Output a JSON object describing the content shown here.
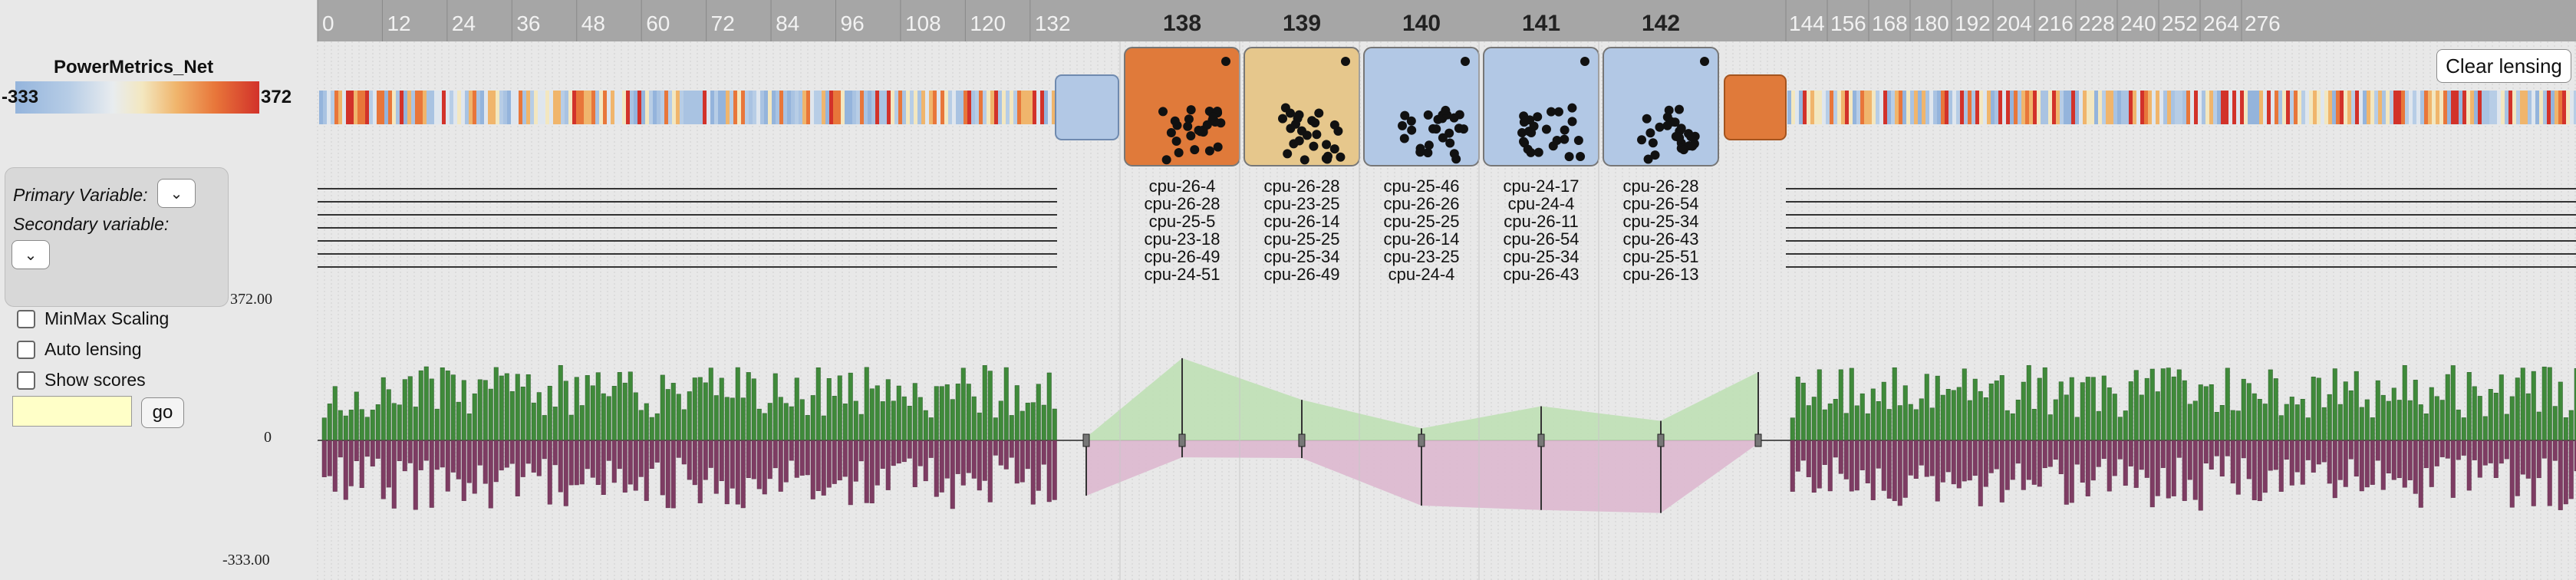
{
  "legend": {
    "title": "PowerMetrics_Net",
    "min_label": "-333",
    "max_label": "372"
  },
  "controls": {
    "primary_label": "Primary Variable:",
    "secondary_label": "Secondary variable:",
    "primary_value": "",
    "secondary_value": "",
    "minmax_label": "MinMax Scaling",
    "autolensing_label": "Auto lensing",
    "showscores_label": "Show scores",
    "search_value": "",
    "go_label": "go",
    "clear_lensing_label": "Clear lensing"
  },
  "colors": {
    "positive": "#3f8a3a",
    "negative": "#7e3c63",
    "pos_area": "#bfe0b5",
    "neg_area": "#ddb8cf",
    "header": "#a6a6a6"
  },
  "chart_data": {
    "type": "bar",
    "title": "",
    "ylim": [
      -333.0,
      372.0
    ],
    "y_tick_labels": [
      "372.00",
      "0",
      "-333.00"
    ],
    "x_tick_labels_left": [
      "0",
      "12",
      "24",
      "36",
      "48",
      "60",
      "72",
      "84",
      "96",
      "108",
      "120",
      "132"
    ],
    "x_tick_labels_right": [
      "144",
      "156",
      "168",
      "180",
      "192",
      "204",
      "216",
      "228",
      "240",
      "252",
      "264",
      "276"
    ],
    "lensed_columns": [
      {
        "index": "138",
        "color": "#e07a3a",
        "cpus": [
          "cpu-26-4",
          "cpu-26-28",
          "cpu-25-5",
          "cpu-23-18",
          "cpu-26-49",
          "cpu-24-51"
        ],
        "max": 219,
        "min": -46
      },
      {
        "index": "139",
        "color": "#e6c78c",
        "cpus": [
          "cpu-26-28",
          "cpu-23-25",
          "cpu-26-14",
          "cpu-25-25",
          "cpu-25-34",
          "cpu-26-49"
        ],
        "max": 108,
        "min": -48
      },
      {
        "index": "140",
        "color": "#b2c8e5",
        "cpus": [
          "cpu-25-46",
          "cpu-26-26",
          "cpu-25-25",
          "cpu-26-14",
          "cpu-23-25",
          "cpu-24-4"
        ],
        "max": 32,
        "min": -177
      },
      {
        "index": "141",
        "color": "#b2c8e5",
        "cpus": [
          "cpu-24-17",
          "cpu-24-4",
          "cpu-26-11",
          "cpu-26-54",
          "cpu-25-34",
          "cpu-26-43"
        ],
        "max": 91,
        "min": -189
      },
      {
        "index": "142",
        "color": "#b2c8e5",
        "cpus": [
          "cpu-26-28",
          "cpu-26-54",
          "cpu-25-34",
          "cpu-26-43",
          "cpu-25-51",
          "cpu-26-13"
        ],
        "max": 52,
        "min": -197
      }
    ]
  }
}
